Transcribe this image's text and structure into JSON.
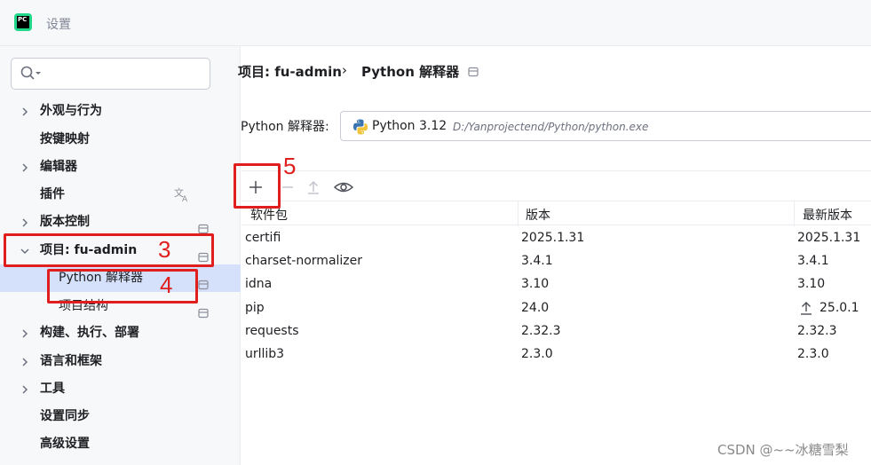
{
  "window": {
    "title": "设置"
  },
  "sidebar": {
    "items": [
      {
        "label": "外观与行为",
        "expandable": true
      },
      {
        "label": "按键映射",
        "expandable": false
      },
      {
        "label": "编辑器",
        "expandable": true
      },
      {
        "label": "插件",
        "expandable": false,
        "icon": "translate-icon"
      },
      {
        "label": "版本控制",
        "expandable": true,
        "icon": "project-scope-icon"
      },
      {
        "label": "项目: fu-admin",
        "expandable": true,
        "expanded": true,
        "icon": "project-scope-icon"
      },
      {
        "label": "Python 解释器",
        "child": true,
        "selected": true,
        "icon": "project-scope-icon"
      },
      {
        "label": "项目结构",
        "child": true,
        "icon": "project-scope-icon"
      },
      {
        "label": "构建、执行、部署",
        "expandable": true
      },
      {
        "label": "语言和框架",
        "expandable": true
      },
      {
        "label": "工具",
        "expandable": true
      },
      {
        "label": "设置同步",
        "expandable": false
      },
      {
        "label": "高级设置",
        "expandable": false
      }
    ]
  },
  "breadcrumb": {
    "project": "项目: fu-admin",
    "separator": "›",
    "page": "Python 解释器"
  },
  "interpreter": {
    "label": "Python 解释器:",
    "name": "Python 3.12",
    "path": "D:/Yanprojectend/Python/python.exe"
  },
  "toolbar": {
    "icons": [
      "add-icon",
      "remove-icon",
      "upgrade-icon",
      "eye-icon"
    ]
  },
  "table": {
    "columns": [
      "软件包",
      "版本",
      "最新版本"
    ],
    "rows": [
      {
        "package": "certifi",
        "version": "2025.1.31",
        "latest": "2025.1.31",
        "upgradable": false
      },
      {
        "package": "charset-normalizer",
        "version": "3.4.1",
        "latest": "3.4.1",
        "upgradable": false
      },
      {
        "package": "idna",
        "version": "3.10",
        "latest": "3.10",
        "upgradable": false
      },
      {
        "package": "pip",
        "version": "24.0",
        "latest": "25.0.1",
        "upgradable": true
      },
      {
        "package": "requests",
        "version": "2.32.3",
        "latest": "2.32.3",
        "upgradable": false
      },
      {
        "package": "urllib3",
        "version": "2.3.0",
        "latest": "2.3.0",
        "upgradable": false
      }
    ]
  },
  "annotations": {
    "step3": "3",
    "step4": "4",
    "step5": "5",
    "color": "#e01e1e"
  },
  "watermark": "CSDN @~~冰糖雪梨",
  "colors": {
    "selection": "#d5e1fb",
    "sidebar_bg": "#f7f8fa",
    "accent": "#3574f0"
  }
}
